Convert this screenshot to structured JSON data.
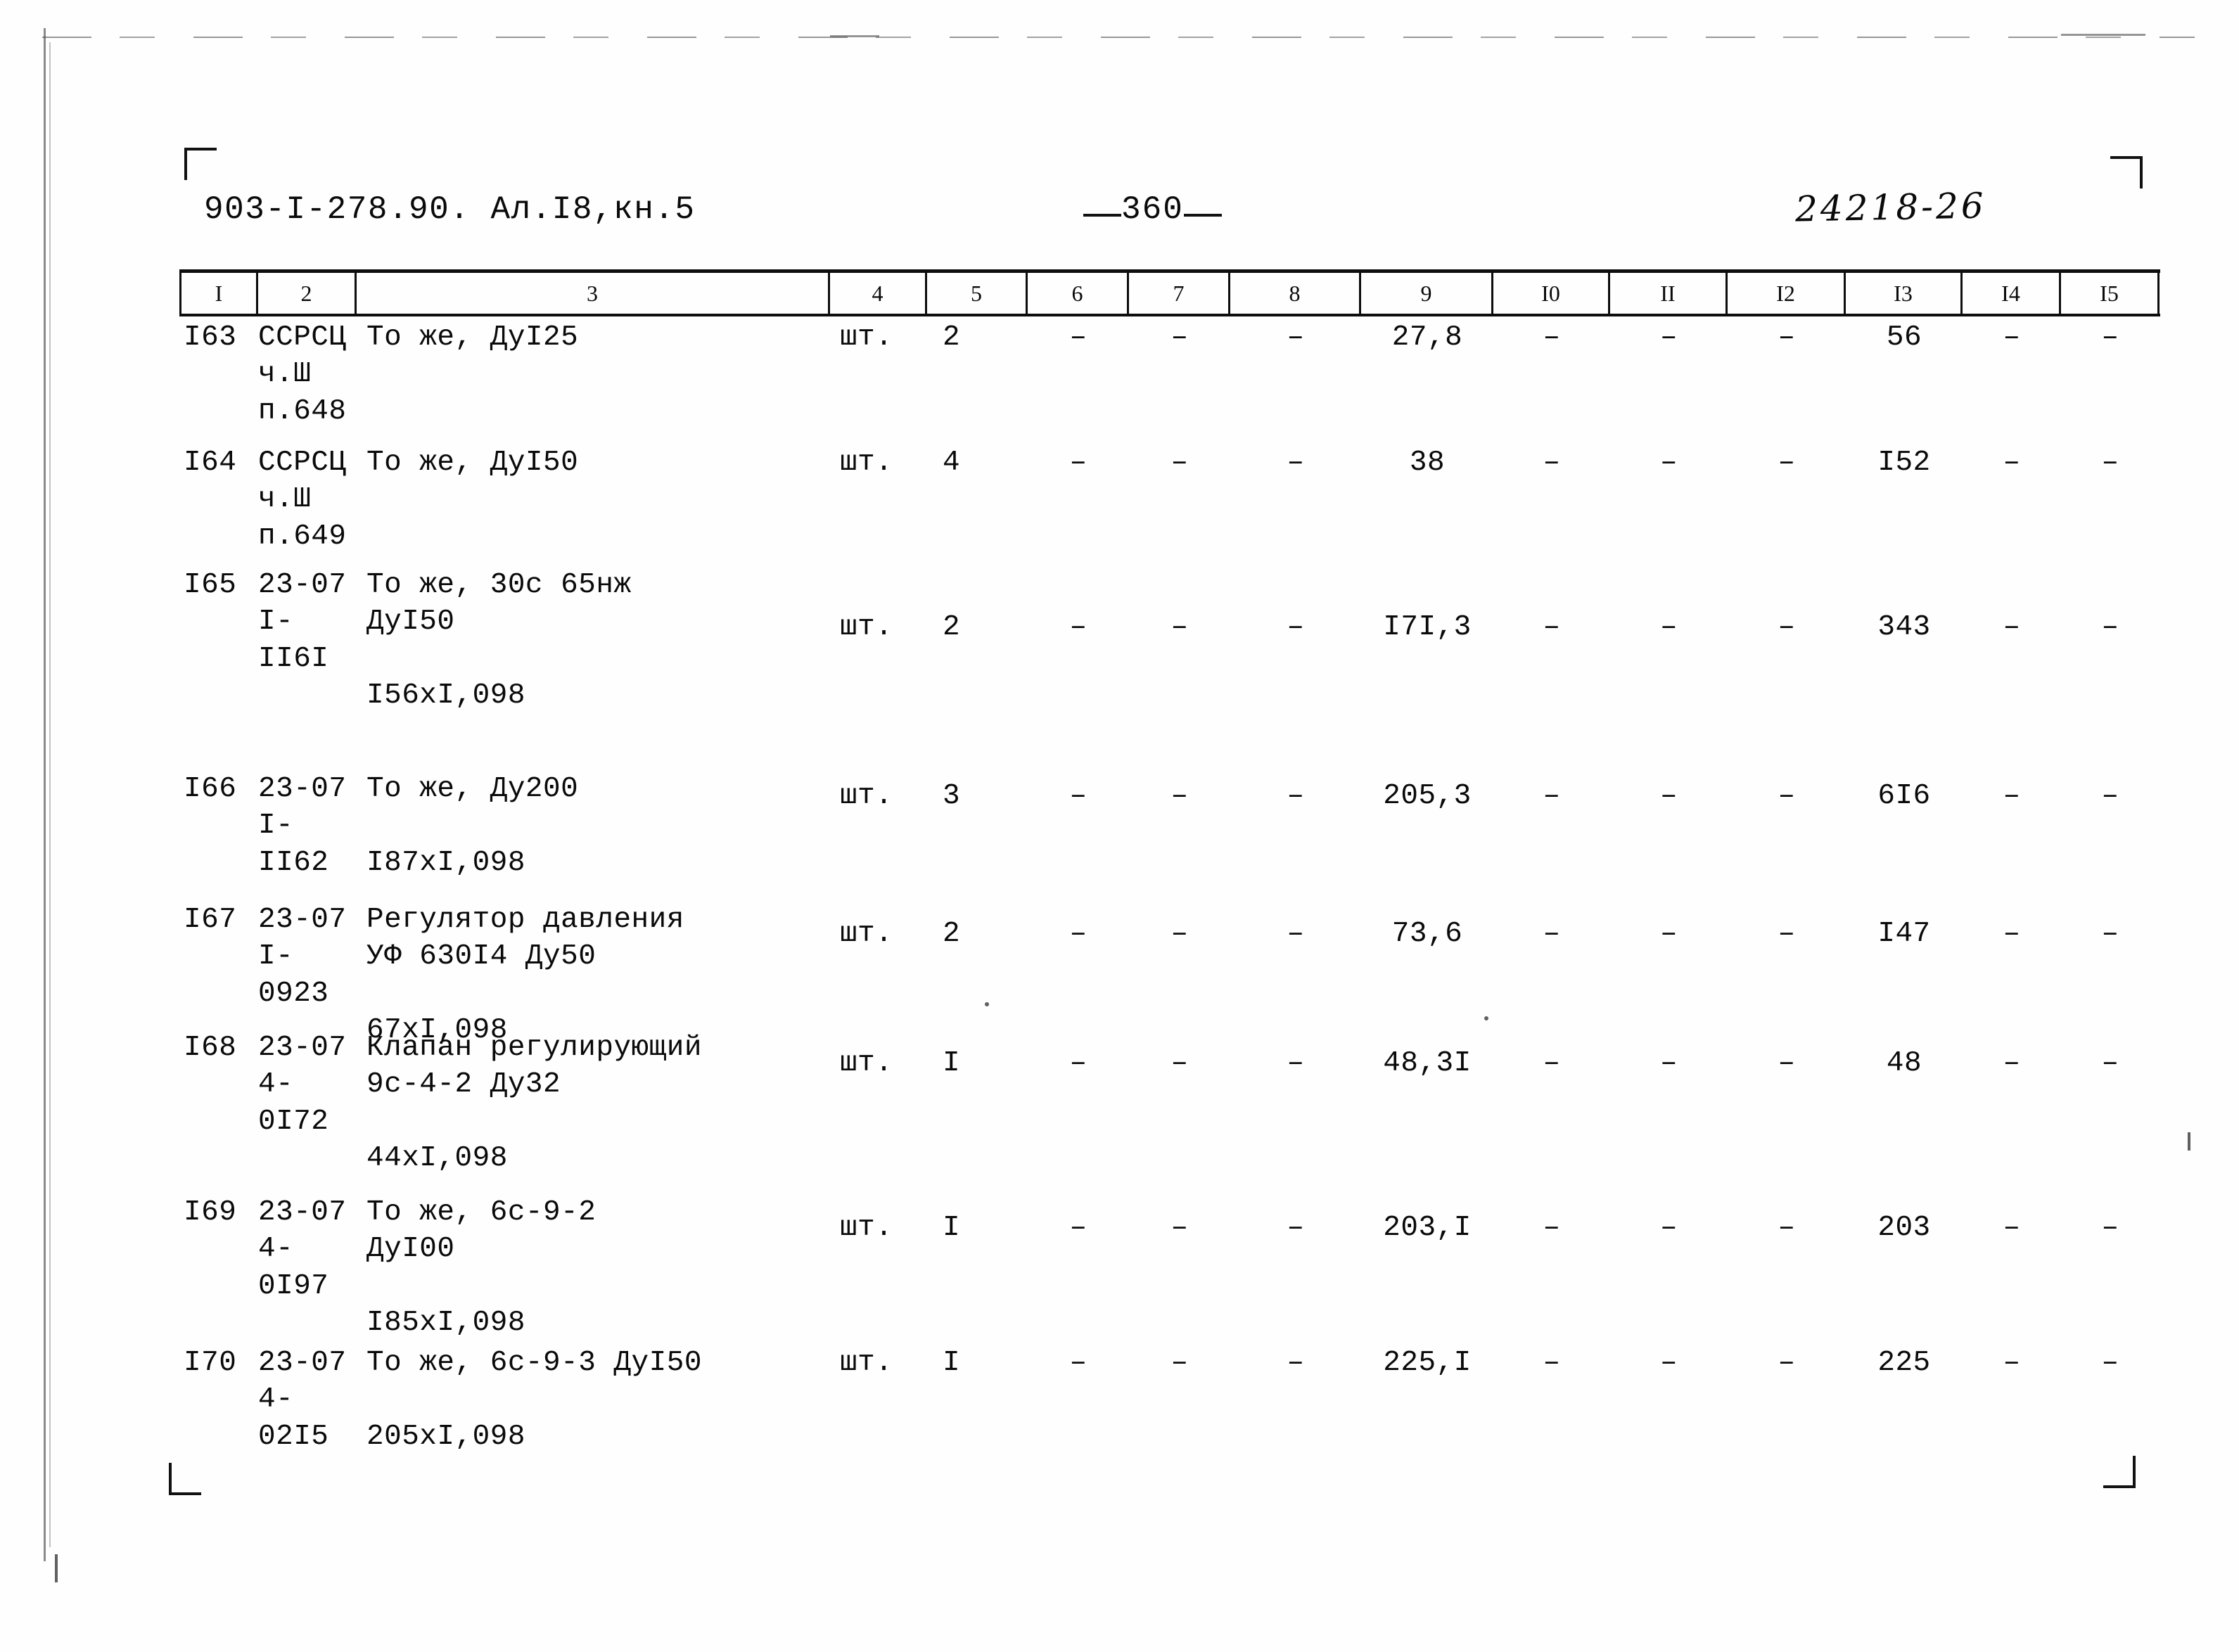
{
  "header": {
    "doc_code": "903-I-278.90. Ал.I8,кн.5",
    "page_number": "360",
    "stamp_number": "24218-26"
  },
  "table": {
    "column_headers": [
      "I",
      "2",
      "3",
      "4",
      "5",
      "6",
      "7",
      "8",
      "9",
      "I0",
      "II",
      "I2",
      "I3",
      "I4",
      "I5"
    ],
    "dash": "–",
    "rows": [
      {
        "num": "I63",
        "code": "ССРСЦ\nч.Ш\nп.648",
        "name": "То же, ДуI25",
        "unit": "шт.",
        "qty": "2",
        "c6": "–",
        "c7": "–",
        "c8": "–",
        "c9": "27,8",
        "c10": "–",
        "c11": "–",
        "c12": "–",
        "c13": "56",
        "c14": "–",
        "c15": "–"
      },
      {
        "num": "I64",
        "code": "ССРСЦ\nч.Ш\nп.649",
        "name": "То же, ДуI50",
        "unit": "шт.",
        "qty": "4",
        "c6": "–",
        "c7": "–",
        "c8": "–",
        "c9": "38",
        "c10": "–",
        "c11": "–",
        "c12": "–",
        "c13": "I52",
        "c14": "–",
        "c15": "–"
      },
      {
        "num": "I65",
        "code": "23-07\nI-II6I",
        "name": "То же, 30с 65нж\nДуI50\n\nI56xI,098",
        "unit": "шт.",
        "qty": "2",
        "c6": "–",
        "c7": "–",
        "c8": "–",
        "c9": "I7I,3",
        "c10": "–",
        "c11": "–",
        "c12": "–",
        "c13": "343",
        "c14": "–",
        "c15": "–"
      },
      {
        "num": "I66",
        "code": "23-07\nI-II62",
        "name": "То же, Ду200\n\nI87xI,098",
        "unit": "шт.",
        "qty": "3",
        "c6": "–",
        "c7": "–",
        "c8": "–",
        "c9": "205,3",
        "c10": "–",
        "c11": "–",
        "c12": "–",
        "c13": "6I6",
        "c14": "–",
        "c15": "–"
      },
      {
        "num": "I67",
        "code": "23-07\nI-0923",
        "name": "Регулятор давления\nУФ 630I4 Ду50\n\n67xI,098",
        "unit": "шт.",
        "qty": "2",
        "c6": "–",
        "c7": "–",
        "c8": "–",
        "c9": "73,6",
        "c10": "–",
        "c11": "–",
        "c12": "–",
        "c13": "I47",
        "c14": "–",
        "c15": "–"
      },
      {
        "num": "I68",
        "code": "23-07\n4-0I72",
        "name": "Клапан регулирующий\n9с-4-2 Ду32\n\n44xI,098",
        "unit": "шт.",
        "qty": "I",
        "c6": "–",
        "c7": "–",
        "c8": "–",
        "c9": "48,3I",
        "c10": "–",
        "c11": "–",
        "c12": "–",
        "c13": "48",
        "c14": "–",
        "c15": "–"
      },
      {
        "num": "I69",
        "code": "23-07\n4-0I97",
        "name": "То же, 6с-9-2\nДуI00\n\nI85xI,098",
        "unit": "шт.",
        "qty": "I",
        "c6": "–",
        "c7": "–",
        "c8": "–",
        "c9": "203,I",
        "c10": "–",
        "c11": "–",
        "c12": "–",
        "c13": "203",
        "c14": "–",
        "c15": "–"
      },
      {
        "num": "I70",
        "code": "23-07\n4-02I5",
        "name": "То же, 6с-9-3 ДуI50\n\n205xI,098",
        "unit": "шт.",
        "qty": "I",
        "c6": "–",
        "c7": "–",
        "c8": "–",
        "c9": "225,I",
        "c10": "–",
        "c11": "–",
        "c12": "–",
        "c13": "225",
        "c14": "–",
        "c15": "–"
      }
    ]
  }
}
